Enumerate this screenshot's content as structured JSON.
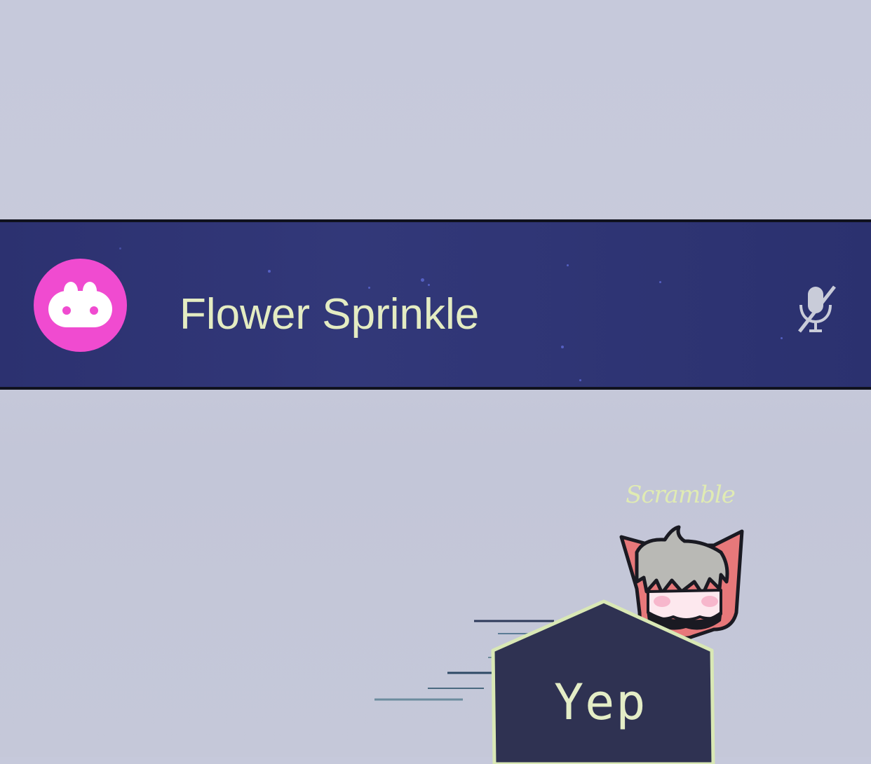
{
  "call_bar": {
    "room_name": "Flower Sprinkle",
    "app_icon": "bunny-icon",
    "mic_icon": "microphone-muted-icon",
    "accent_color": "#f04bd0",
    "text_color": "#e4ecc2"
  },
  "participant": {
    "name": "Scramble",
    "avatar_icon": "cat-character-avatar",
    "message": "Yep",
    "bubble_color": "#2f3252",
    "bubble_outline": "#d9e8b5"
  }
}
